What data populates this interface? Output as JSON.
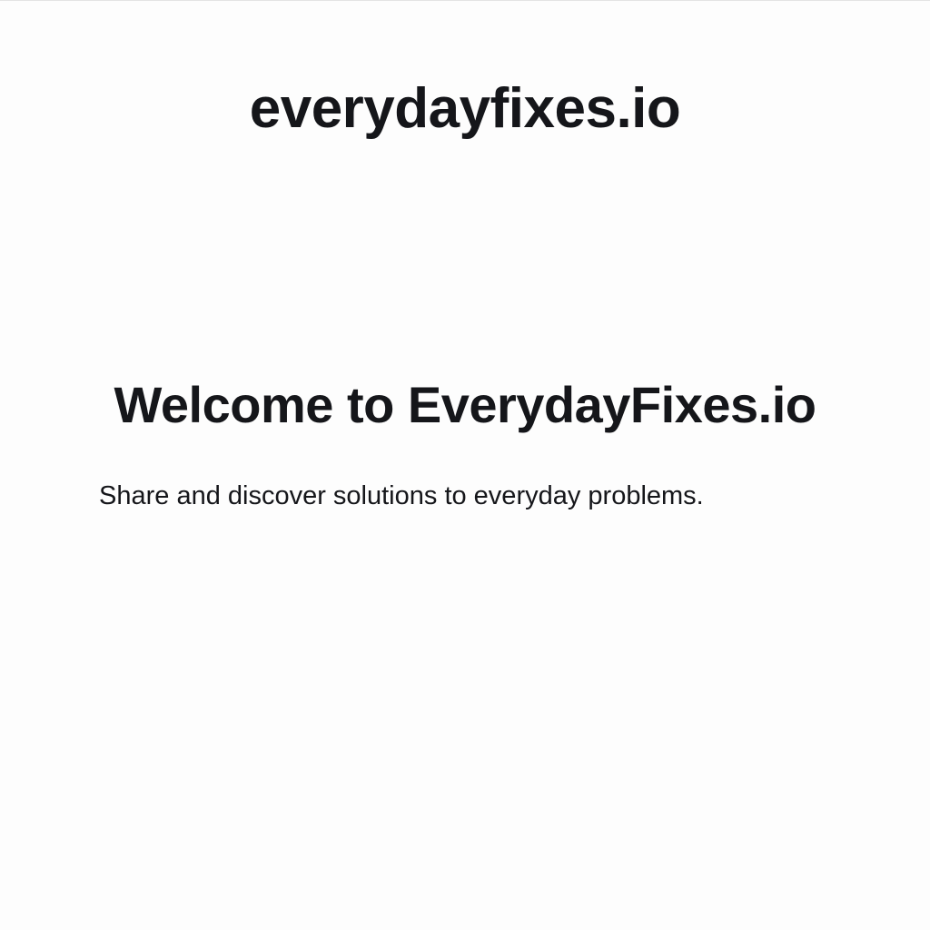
{
  "header": {
    "brand": "everydayfixes.io"
  },
  "hero": {
    "title": "Welcome to EverydayFixes.io",
    "subtitle": "Share and discover solutions to everyday problems."
  },
  "colors": {
    "background": "#fdfdfd",
    "text": "#15161a"
  }
}
